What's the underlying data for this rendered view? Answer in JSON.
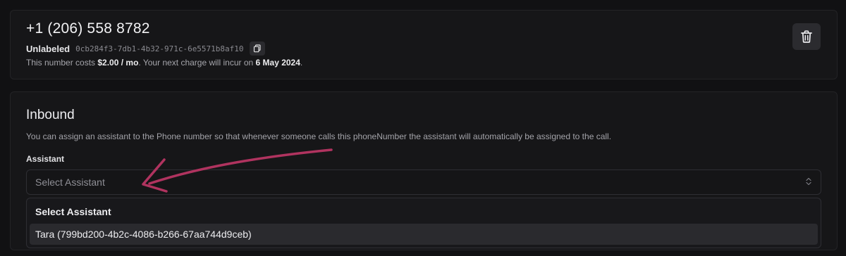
{
  "phone": {
    "number": "+1 (206) 558 8782",
    "label": "Unlabeled",
    "id": "0cb284f3-7db1-4b32-971c-6e5571b8af10",
    "cost_prefix": "This number costs ",
    "cost_amount": "$2.00 / mo",
    "cost_middle": ". Your next charge will incur on ",
    "next_charge_date": "6 May 2024",
    "cost_suffix": "."
  },
  "inbound": {
    "title": "Inbound",
    "description": "You can assign an assistant to the Phone number so that whenever someone calls this phoneNumber the assistant will automatically be assigned to the call.",
    "assistant_label": "Assistant",
    "select_placeholder": "Select Assistant",
    "options_header": "Select Assistant",
    "options": [
      "Tara (799bd200-4b2c-4086-b266-67aa744d9ceb)"
    ]
  },
  "icons": {
    "copy": "copy-icon",
    "delete": "trash-icon",
    "select": "chevron-up-down-icon"
  },
  "colors": {
    "background": "#111113",
    "card": "#161618",
    "annotation_arrow": "#b0335f"
  }
}
